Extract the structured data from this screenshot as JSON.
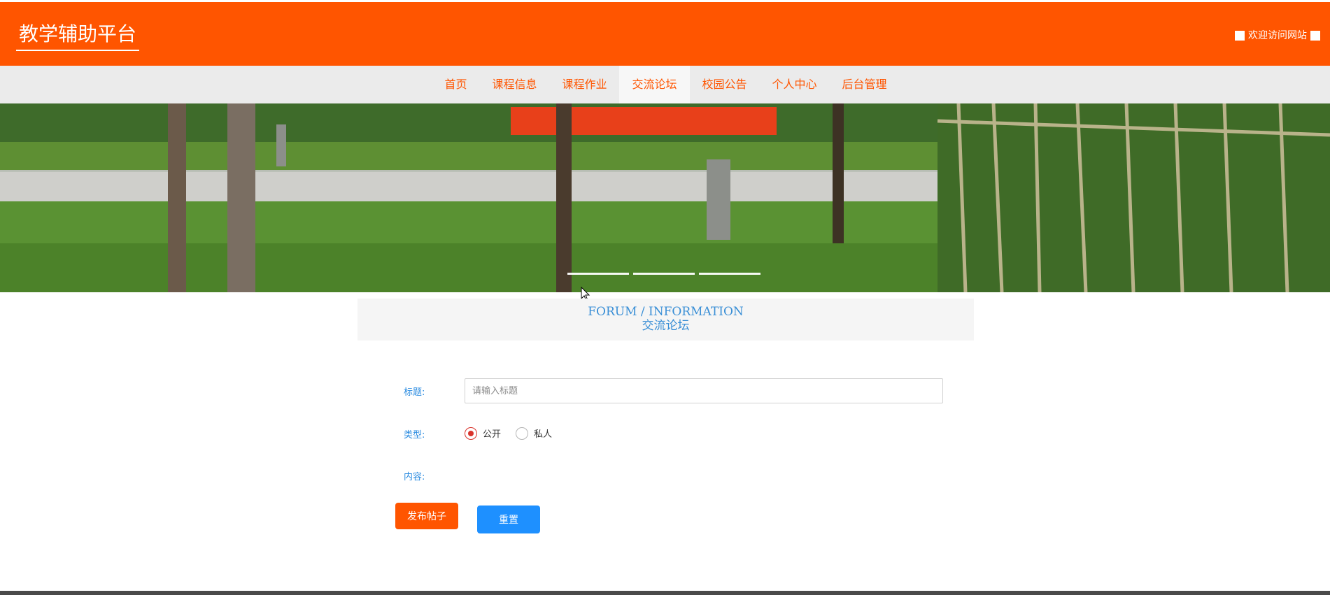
{
  "header": {
    "brand": "教学辅助平台",
    "welcome": "欢迎访问网站",
    "bg_color": "#ff5500"
  },
  "nav": {
    "items": [
      {
        "label": "首页"
      },
      {
        "label": "课程信息"
      },
      {
        "label": "课程作业"
      },
      {
        "label": "交流论坛",
        "active": true
      },
      {
        "label": "校园公告"
      },
      {
        "label": "个人中心"
      },
      {
        "label": "后台管理"
      }
    ],
    "color": "#ff5500"
  },
  "banner": {
    "slides": 3
  },
  "section": {
    "title_en": "FORUM / INFORMATION",
    "title_cn": "交流论坛"
  },
  "form": {
    "title_label": "标题:",
    "title_value": "",
    "title_placeholder": "请输入标题",
    "type_label": "类型:",
    "type_options": [
      "公开",
      "私人"
    ],
    "type_selected": "公开",
    "content_label": "内容:",
    "publish_button": "发布帖子",
    "reset_button": "重置"
  },
  "colors": {
    "accent": "#ff5500",
    "link_blue": "#2a8be0",
    "reset_blue": "#1e90ff",
    "radio_red": "#d9342c"
  }
}
